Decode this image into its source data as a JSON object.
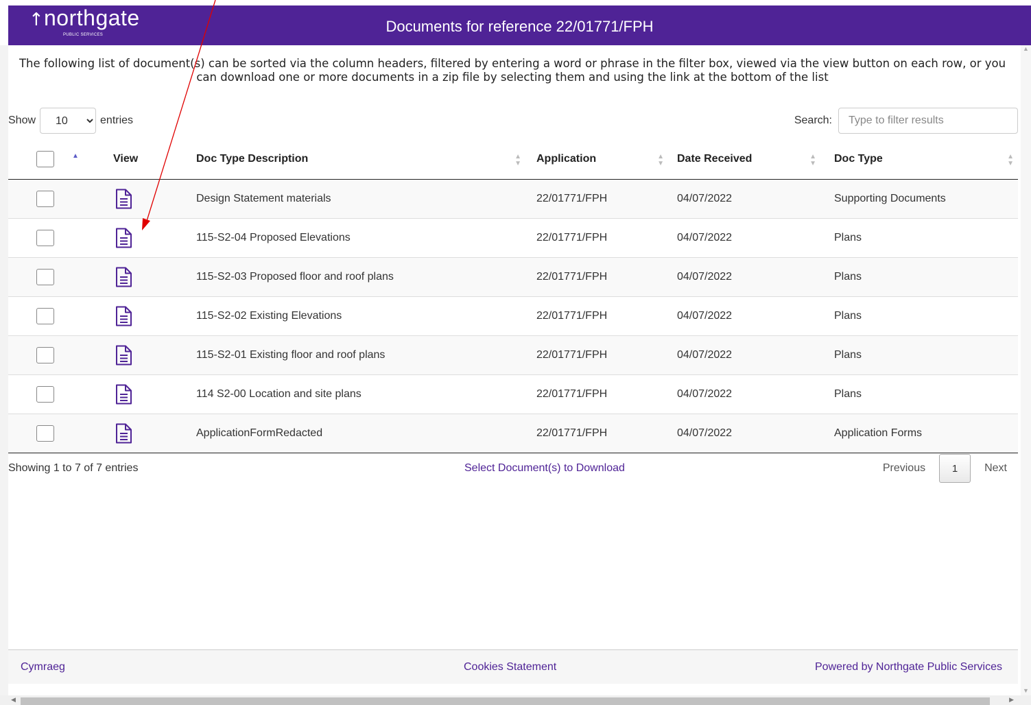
{
  "header": {
    "logo_text": "northgate",
    "logo_arrow": "↑",
    "logo_sub": "PUBLIC SERVICES",
    "title": "Documents for reference 22/01771/FPH"
  },
  "intro_text": "The following list of document(s) can be sorted via the column headers, filtered by entering a word or phrase in the filter box, viewed via the view button on each row, or you can download one or more documents in a zip file by selecting them and using the link at the bottom of the list",
  "length_control": {
    "show_label": "Show",
    "selected": "10",
    "entries_label": "entries"
  },
  "search": {
    "label": "Search:",
    "placeholder": "Type to filter results"
  },
  "columns": {
    "view": "View",
    "desc": "Doc Type Description",
    "app": "Application",
    "date": "Date Received",
    "type": "Doc Type"
  },
  "rows": [
    {
      "desc": "Design Statement materials",
      "app": "22/01771/FPH",
      "date": "04/07/2022",
      "type": "Supporting Documents"
    },
    {
      "desc": "115-S2-04 Proposed Elevations",
      "app": "22/01771/FPH",
      "date": "04/07/2022",
      "type": "Plans"
    },
    {
      "desc": "115-S2-03 Proposed floor and roof plans",
      "app": "22/01771/FPH",
      "date": "04/07/2022",
      "type": "Plans"
    },
    {
      "desc": "115-S2-02 Existing Elevations",
      "app": "22/01771/FPH",
      "date": "04/07/2022",
      "type": "Plans"
    },
    {
      "desc": "115-S2-01 Existing floor and roof plans",
      "app": "22/01771/FPH",
      "date": "04/07/2022",
      "type": "Plans"
    },
    {
      "desc": "114 S2-00 Location and site plans",
      "app": "22/01771/FPH",
      "date": "04/07/2022",
      "type": "Plans"
    },
    {
      "desc": "ApplicationFormRedacted",
      "app": "22/01771/FPH",
      "date": "04/07/2022",
      "type": "Application Forms"
    }
  ],
  "info_text": "Showing 1 to 7 of 7 entries",
  "download_link": "Select Document(s) to Download",
  "pagination": {
    "previous": "Previous",
    "current": "1",
    "next": "Next"
  },
  "footer": {
    "left": "Cymraeg",
    "center": "Cookies Statement",
    "right": "Powered by Northgate Public Services"
  },
  "colors": {
    "brand": "#4f2396",
    "annotation": "#e00000"
  },
  "icons": {
    "view": "document-icon",
    "sort": "sort-arrows-icon"
  }
}
